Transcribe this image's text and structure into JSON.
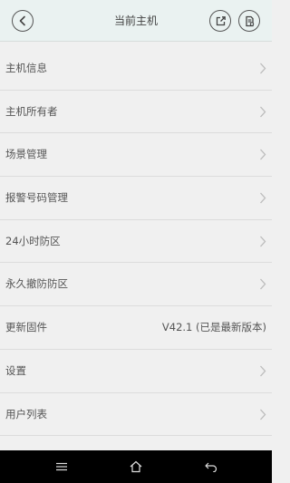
{
  "header": {
    "title": "当前主机",
    "back_icon": "back-arrow-icon",
    "share_icon": "share-icon",
    "doc_icon": "document-icon"
  },
  "list": {
    "items": [
      {
        "label": "主机信息",
        "value": ""
      },
      {
        "label": "主机所有者",
        "value": ""
      },
      {
        "label": "场景管理",
        "value": ""
      },
      {
        "label": "报警号码管理",
        "value": ""
      },
      {
        "label": "24小时防区",
        "value": ""
      },
      {
        "label": "永久撤防防区",
        "value": ""
      },
      {
        "label": "更新固件",
        "value": "V42.1 (已是最新版本)"
      },
      {
        "label": "设置",
        "value": ""
      },
      {
        "label": "用户列表",
        "value": ""
      }
    ]
  },
  "navbar": {
    "icons": [
      "menu-icon",
      "home-icon",
      "back-icon"
    ]
  }
}
